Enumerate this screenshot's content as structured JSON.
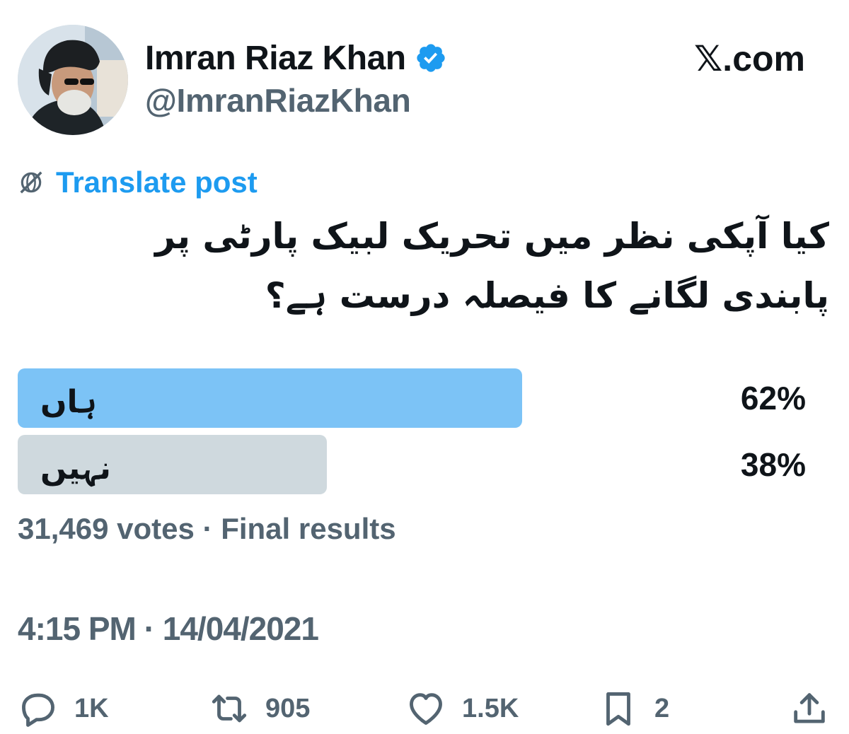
{
  "author": {
    "display_name": "Imran Riaz Khan",
    "handle": "@ImranRiazKhan",
    "verified": true
  },
  "site_mark": "𝕏.com",
  "translate_label": "Translate post",
  "post_text": "کیا آپکی نظر میں تحریک لبیک پارٹی پر پابندی لگانے کا فیصلہ درست ہے؟",
  "poll": {
    "options": [
      {
        "label": "ہاں",
        "percent_text": "62%",
        "share": 0.62,
        "winner": true
      },
      {
        "label": "نہیں",
        "percent_text": "38%",
        "share": 0.38,
        "winner": false
      }
    ],
    "votes_text": "31,469 votes",
    "status_text": "Final results"
  },
  "timestamp": {
    "time": "4:15 PM",
    "date": "14/04/2021"
  },
  "actions": {
    "replies": "1K",
    "reposts": "905",
    "likes": "1.5K",
    "bookmarks": "2"
  },
  "colors": {
    "accent": "#1d9bf0",
    "winner_bar": "#7cc3f6",
    "loser_bar": "#cfd9de",
    "secondary_text": "#536471",
    "primary_text": "#0f1419"
  },
  "icons": {
    "verified": "verified-badge-icon",
    "translate": "globe-slash-icon",
    "reply": "speech-bubble-icon",
    "repost": "repost-arrows-icon",
    "like": "heart-icon",
    "bookmark": "bookmark-icon",
    "share": "share-upload-icon"
  }
}
